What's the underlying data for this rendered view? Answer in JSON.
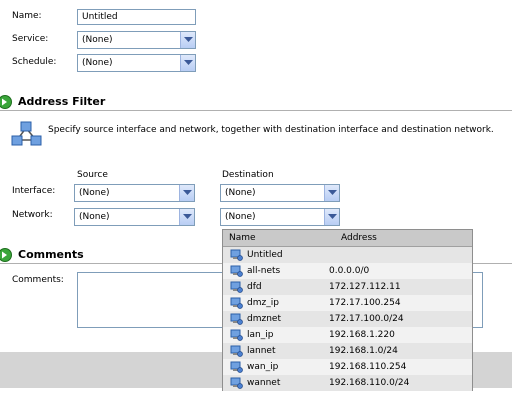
{
  "general": {
    "name_label": "Name:",
    "name_value": "Untitled",
    "service_label": "Service:",
    "service_value": "(None)",
    "schedule_label": "Schedule:",
    "schedule_value": "(None)"
  },
  "address_filter": {
    "title": "Address Filter",
    "description": "Specify source interface and network, together with destination interface and destination network.",
    "source_header": "Source",
    "destination_header": "Destination",
    "interface_label": "Interface:",
    "network_label": "Network:",
    "source_interface": "(None)",
    "source_network": "(None)",
    "destination_interface": "(None)",
    "destination_network": "(None)"
  },
  "comments": {
    "title": "Comments",
    "label": "Comments:",
    "value": ""
  },
  "network_dropdown": {
    "col_name": "Name",
    "col_address": "Address",
    "items": [
      {
        "name": "Untitled",
        "address": ""
      },
      {
        "name": "all-nets",
        "address": "0.0.0.0/0"
      },
      {
        "name": "dfd",
        "address": "172.127.112.11"
      },
      {
        "name": "dmz_ip",
        "address": "172.17.100.254"
      },
      {
        "name": "dmznet",
        "address": "172.17.100.0/24"
      },
      {
        "name": "lan_ip",
        "address": "192.168.1.220"
      },
      {
        "name": "lannet",
        "address": "192.168.1.0/24"
      },
      {
        "name": "wan_ip",
        "address": "192.168.110.254"
      },
      {
        "name": "wannet",
        "address": "192.168.110.0/24"
      }
    ]
  },
  "icons": {
    "section_arrow": "green-arrow-icon",
    "network_diagram": "network-nodes-icon",
    "address_object": "network-object-icon"
  },
  "colors": {
    "input_border": "#7f9db9",
    "combo_button": "#c6d6f6",
    "arrow_green": "#3aa53a",
    "list_header": "#c9c9c9"
  }
}
